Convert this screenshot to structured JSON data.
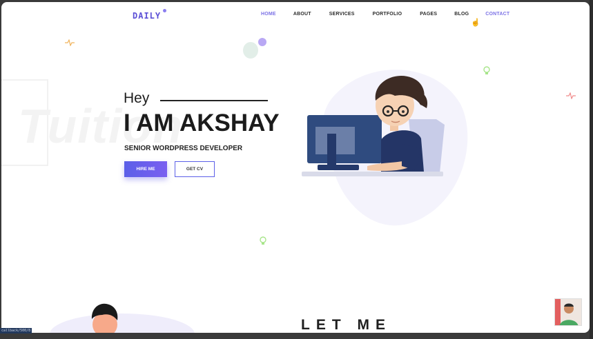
{
  "brand": {
    "logo": "DAILY"
  },
  "nav": {
    "items": [
      {
        "label": "HOME",
        "active": true
      },
      {
        "label": "ABOUT",
        "active": false
      },
      {
        "label": "SERVICES",
        "active": false
      },
      {
        "label": "PORTFOLIO",
        "active": false
      },
      {
        "label": "PAGES",
        "active": false
      },
      {
        "label": "BLOG",
        "active": false
      },
      {
        "label": "CONTACT",
        "active": false
      }
    ]
  },
  "hero": {
    "greeting": "Hey",
    "name": "I AM AKSHAY",
    "role": "SENIOR WORDPRESS DEVELOPER",
    "primary_button": "HIRE ME",
    "secondary_button": "GET CV",
    "watermark": "Tuition"
  },
  "section": {
    "heading": "LET ME"
  },
  "status_bar": {
    "text": "callback/500/8"
  },
  "colors": {
    "accent": "#7c72e6",
    "button": "#5b5fe8",
    "text": "#1b1b1b"
  },
  "icons": [
    "pulse-icon",
    "bulb-icon",
    "hand-cursor-icon"
  ]
}
